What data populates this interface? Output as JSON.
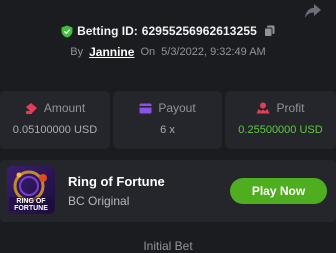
{
  "bet": {
    "label": "Betting ID:",
    "id": "62955256962613255",
    "by_label": "By",
    "user": "Jannine",
    "on_label": "On",
    "datetime": "5/3/2022, 9:32:49 AM"
  },
  "stats": [
    {
      "label": "Amount",
      "value": "0.05100000 USD",
      "icon": "amount-icon"
    },
    {
      "label": "Payout",
      "value": "6 x",
      "icon": "payout-icon"
    },
    {
      "label": "Profit",
      "value": "0.25500000 USD",
      "icon": "profit-icon"
    }
  ],
  "game": {
    "name": "Ring of Fortune",
    "provider": "BC Original",
    "thumb_text": "RING OF FORTUNE",
    "play_label": "Play Now"
  },
  "section": {
    "title": "Initial Bet"
  },
  "colors": {
    "background": "#1b1c20",
    "card": "#24262b",
    "accent_green": "#4fae1f",
    "profit_green": "#5fca3a",
    "muted": "#8f949c"
  }
}
